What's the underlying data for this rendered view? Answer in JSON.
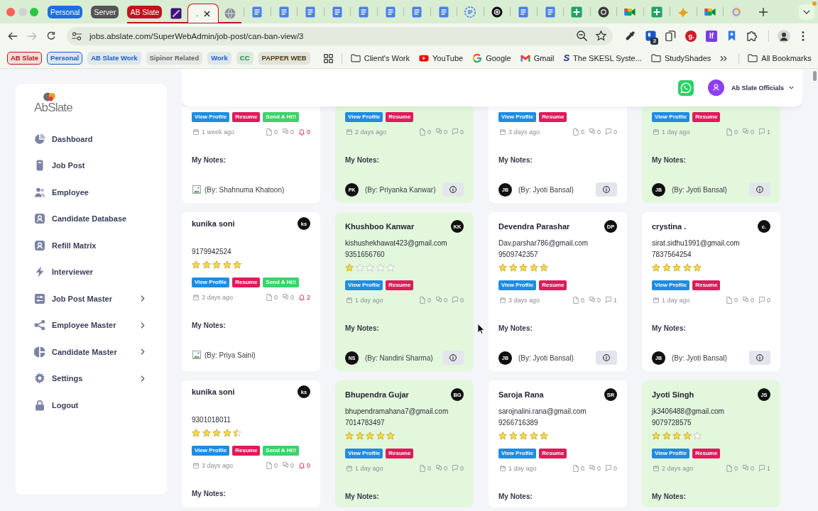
{
  "browser": {
    "tab_groups": [
      {
        "label": "Personal",
        "color": "#1b6fdf"
      },
      {
        "label": "Server",
        "color": "#555555"
      },
      {
        "label": "AB Slate",
        "color": "#c0141b",
        "tabs": [
          {
            "kind": "stripe-app",
            "selected": false
          },
          {
            "kind": "blank",
            "title": ".",
            "selected": true
          },
          {
            "kind": "globe",
            "selected": false
          }
        ]
      }
    ],
    "tabs": [
      {
        "kind": "docs",
        "selected": false
      },
      {
        "kind": "docs",
        "selected": false
      },
      {
        "kind": "docs",
        "selected": false
      },
      {
        "kind": "docs",
        "selected": false
      },
      {
        "kind": "docs",
        "selected": false
      },
      {
        "kind": "docs",
        "selected": false
      },
      {
        "kind": "docs",
        "selected": false
      },
      {
        "kind": "docs",
        "selected": false
      },
      {
        "kind": "docs-round",
        "selected": false
      },
      {
        "kind": "knot",
        "selected": false
      },
      {
        "kind": "docs",
        "selected": false
      },
      {
        "kind": "docs",
        "selected": false
      },
      {
        "kind": "sheets",
        "selected": false
      },
      {
        "kind": "ring",
        "selected": false
      },
      {
        "kind": "camera",
        "selected": false
      },
      {
        "kind": "sheets",
        "selected": false
      },
      {
        "kind": "bird",
        "selected": false
      },
      {
        "kind": "camera",
        "selected": false
      },
      {
        "kind": "loader",
        "selected": false
      }
    ],
    "nav_buttons": [
      {
        "kind": "back",
        "disabled": false
      },
      {
        "kind": "forward",
        "disabled": true
      },
      {
        "kind": "reload",
        "disabled": false
      }
    ],
    "address": {
      "url": "jobs.abslate.com/SuperWebAdmin/job-post/can-ban-view/3"
    },
    "extensions": [
      {
        "kind": "eyedropper"
      },
      {
        "kind": "app",
        "badge": "2"
      },
      {
        "kind": "copy"
      },
      {
        "kind": "letter-round",
        "text": "g.",
        "color": "#c8202a"
      },
      {
        "kind": "letter-square",
        "text": "lf",
        "color": "#7c3aed"
      },
      {
        "kind": "ribbon"
      },
      {
        "kind": "puzzle"
      }
    ],
    "bookmark_groups": [
      {
        "label": "AB Slate",
        "color": "#c0141b",
        "open": true
      },
      {
        "label": "Personal",
        "color": "#1b5fc4",
        "open": true
      },
      {
        "label": "AB Slate Work",
        "color": "#1b5fc4",
        "open": false
      },
      {
        "label": "Sipinor Related",
        "color": "#5f6368",
        "open": false
      },
      {
        "label": "Work",
        "color": "#1b5fc4",
        "open": false
      },
      {
        "label": "CC",
        "color": "#188038",
        "open": false
      },
      {
        "label": "PAPPER WEB",
        "color": "#4a3a10",
        "open": false
      }
    ],
    "bookmarks": [
      {
        "kind": "folder",
        "label": "Client's Work"
      },
      {
        "kind": "play",
        "label": "YouTube"
      },
      {
        "kind": "ring",
        "label": "Google"
      },
      {
        "kind": "envelope",
        "label": "Gmail"
      },
      {
        "kind": "lettermark",
        "logo_text": "S",
        "label": "The SKESL Syste..."
      },
      {
        "kind": "folder",
        "label": "StudyShades"
      }
    ],
    "all_bookmarks": "All Bookmarks"
  },
  "sidebar": {
    "logo": "AbSlate",
    "items": [
      {
        "label": "Dashboard",
        "kind": "pie",
        "expandable": false,
        "selected": false
      },
      {
        "label": "Job Post",
        "kind": "doc",
        "expandable": false,
        "selected": false
      },
      {
        "label": "Employee",
        "kind": "users",
        "expandable": false,
        "selected": false
      },
      {
        "label": "Candidate Database",
        "kind": "user-card",
        "expandable": false,
        "selected": false
      },
      {
        "label": "Refill Matrix",
        "kind": "user-card",
        "expandable": false,
        "selected": false
      },
      {
        "label": "Interviewer",
        "kind": "bolt",
        "expandable": false,
        "selected": false
      },
      {
        "label": "Job Post Master",
        "kind": "sliders",
        "expandable": true,
        "selected": false
      },
      {
        "label": "Employee Master",
        "kind": "nodes",
        "expandable": true,
        "selected": false
      },
      {
        "label": "Candidate Master",
        "kind": "half-pie",
        "expandable": true,
        "selected": false
      },
      {
        "label": "Settings",
        "kind": "gear",
        "expandable": true,
        "selected": false
      },
      {
        "label": "Logout",
        "kind": "lock",
        "expandable": false,
        "selected": false
      }
    ]
  },
  "header": {
    "account": "Ab Slate Officials"
  },
  "cards": [
    {
      "highlighted": false,
      "buttons": [
        {
          "label": "View Profile",
          "kind": "profile"
        },
        {
          "label": "Resume",
          "kind": "resume"
        },
        {
          "label": "Send A Hi!!",
          "kind": "hi"
        }
      ],
      "time": "1 week ago",
      "counts": [
        {
          "kind": "files",
          "value": "0"
        },
        {
          "kind": "chats",
          "value": "0"
        },
        {
          "kind": "alerts",
          "value": "0"
        }
      ],
      "notes_label": "My Notes:",
      "note": {
        "kind": "image",
        "by": "(By: Shahnuma Khatoon)",
        "info": false
      }
    },
    {
      "highlighted": true,
      "buttons": [
        {
          "label": "View Profile",
          "kind": "profile"
        },
        {
          "label": "Resume",
          "kind": "resume"
        }
      ],
      "time": "2 days ago",
      "counts": [
        {
          "kind": "files",
          "value": "0"
        },
        {
          "kind": "chats",
          "value": "0"
        },
        {
          "kind": "comments",
          "value": "0"
        }
      ],
      "notes_label": "My Notes:",
      "note": {
        "kind": "initials",
        "initials": "PK",
        "by": "(By: Priyanka Kanwar)",
        "info": true
      }
    },
    {
      "highlighted": false,
      "buttons": [
        {
          "label": "View Profile",
          "kind": "profile"
        },
        {
          "label": "Resume",
          "kind": "resume"
        }
      ],
      "time": "3 days ago",
      "counts": [
        {
          "kind": "files",
          "value": "0"
        },
        {
          "kind": "chats",
          "value": "0"
        },
        {
          "kind": "comments",
          "value": "0"
        }
      ],
      "notes_label": "My Notes:",
      "note": {
        "kind": "initials",
        "initials": "JB",
        "by": "(By: Jyoti Bansal)",
        "info": true
      }
    },
    {
      "highlighted": true,
      "buttons": [
        {
          "label": "View Profile",
          "kind": "profile"
        },
        {
          "label": "Resume",
          "kind": "resume"
        }
      ],
      "time": "1 day ago",
      "counts": [
        {
          "kind": "files",
          "value": "0"
        },
        {
          "kind": "chats",
          "value": "0"
        },
        {
          "kind": "comments",
          "value": "1"
        }
      ],
      "notes_label": "My Notes:",
      "note": {
        "kind": "initials",
        "initials": "JB",
        "by": "(By: Jyoti Bansal)",
        "info": true
      }
    },
    {
      "highlighted": false,
      "name": "kunika soni",
      "initials": "ks",
      "phone": "9179942524",
      "stars": 5,
      "buttons": [
        {
          "label": "View Profile",
          "kind": "profile"
        },
        {
          "label": "Resume",
          "kind": "resume"
        },
        {
          "label": "Send A Hi!!",
          "kind": "hi"
        }
      ],
      "time": "3 days ago",
      "counts": [
        {
          "kind": "files",
          "value": "0"
        },
        {
          "kind": "chats",
          "value": "0"
        },
        {
          "kind": "alerts",
          "value": "2"
        }
      ],
      "notes_label": "My Notes:",
      "note": {
        "kind": "image",
        "by": "(By: Priya Saini)",
        "info": false
      }
    },
    {
      "highlighted": true,
      "name": "Khushboo Kanwar",
      "initials": "KK",
      "email": "kishushekhawat423@gmail.com",
      "phone": "9351656760",
      "stars": 1,
      "buttons": [
        {
          "label": "View Profile",
          "kind": "profile"
        },
        {
          "label": "Resume",
          "kind": "resume"
        }
      ],
      "time": "1 day ago",
      "counts": [
        {
          "kind": "files",
          "value": "0"
        },
        {
          "kind": "chats",
          "value": "0"
        },
        {
          "kind": "comments",
          "value": "0"
        }
      ],
      "notes_label": "My Notes:",
      "note": {
        "kind": "initials",
        "initials": "NS",
        "by": "(By: Nandini Sharma)",
        "info": true
      }
    },
    {
      "highlighted": false,
      "name": "Devendra Parashar",
      "initials": "DP",
      "email": "Dav.parshar786@gmail.com",
      "phone": "9509742357",
      "stars": 5,
      "buttons": [
        {
          "label": "View Profile",
          "kind": "profile"
        },
        {
          "label": "Resume",
          "kind": "resume"
        }
      ],
      "time": "3 days ago",
      "counts": [
        {
          "kind": "files",
          "value": "0"
        },
        {
          "kind": "chats",
          "value": "0"
        },
        {
          "kind": "comments",
          "value": "1"
        }
      ],
      "notes_label": "My Notes:",
      "note": {
        "kind": "initials",
        "initials": "JB",
        "by": "(By: Jyoti Bansal)",
        "info": true
      }
    },
    {
      "highlighted": false,
      "name": "crystina .",
      "initials": "c.",
      "email": "sirat.sidhu1991@gmail.com",
      "phone": "7837564254",
      "stars": 5,
      "buttons": [
        {
          "label": "View Profile",
          "kind": "profile"
        },
        {
          "label": "Resume",
          "kind": "resume"
        }
      ],
      "time": "1 day ago",
      "counts": [
        {
          "kind": "files",
          "value": "0"
        },
        {
          "kind": "chats",
          "value": "0"
        },
        {
          "kind": "comments",
          "value": "0"
        }
      ],
      "notes_label": "My Notes:",
      "note": {
        "kind": "initials",
        "initials": "JB",
        "by": "(By: Jyoti Bansal)",
        "info": true
      }
    },
    {
      "highlighted": false,
      "name": "kunika soni",
      "initials": "ks",
      "phone": "9301018011",
      "stars": 4.5,
      "buttons": [
        {
          "label": "View Profile",
          "kind": "profile"
        },
        {
          "label": "Resume",
          "kind": "resume"
        },
        {
          "label": "Send A Hi!!",
          "kind": "hi"
        }
      ],
      "time": "3 days ago",
      "counts": [
        {
          "kind": "files",
          "value": "0"
        },
        {
          "kind": "chats",
          "value": "0"
        },
        {
          "kind": "alerts",
          "value": "0"
        }
      ],
      "notes_label": "My Notes:"
    },
    {
      "highlighted": true,
      "name": "Bhupendra Gujar",
      "initials": "BG",
      "email": "bhupendramahana7@gmail.com",
      "phone": "7014783497",
      "stars": 5,
      "buttons": [
        {
          "label": "View Profile",
          "kind": "profile"
        },
        {
          "label": "Resume",
          "kind": "resume"
        }
      ],
      "time": "1 day ago",
      "counts": [
        {
          "kind": "files",
          "value": "0"
        },
        {
          "kind": "chats",
          "value": "0"
        },
        {
          "kind": "comments",
          "value": "0"
        }
      ],
      "notes_label": "My Notes:"
    },
    {
      "highlighted": false,
      "name": "Saroja Rana",
      "initials": "SR",
      "email": "sarojnalini.rana@gmail.com",
      "phone": "9266716389",
      "stars": 5,
      "buttons": [
        {
          "label": "View Profile",
          "kind": "profile"
        },
        {
          "label": "Resume",
          "kind": "resume"
        }
      ],
      "time": "1 day ago",
      "counts": [
        {
          "kind": "files",
          "value": "0"
        },
        {
          "kind": "chats",
          "value": "0"
        },
        {
          "kind": "comments",
          "value": "0"
        }
      ],
      "notes_label": "My Notes:"
    },
    {
      "highlighted": true,
      "name": "Jyoti Singh",
      "initials": "JS",
      "email": "jk3406488@gmail.com",
      "phone": "9079728575",
      "stars": 4,
      "buttons": [
        {
          "label": "View Profile",
          "kind": "profile"
        },
        {
          "label": "Resume",
          "kind": "resume"
        }
      ],
      "time": "2 days ago",
      "counts": [
        {
          "kind": "files",
          "value": "0"
        },
        {
          "kind": "chats",
          "value": "0"
        },
        {
          "kind": "comments",
          "value": "1"
        }
      ],
      "notes_label": "My Notes:"
    }
  ]
}
